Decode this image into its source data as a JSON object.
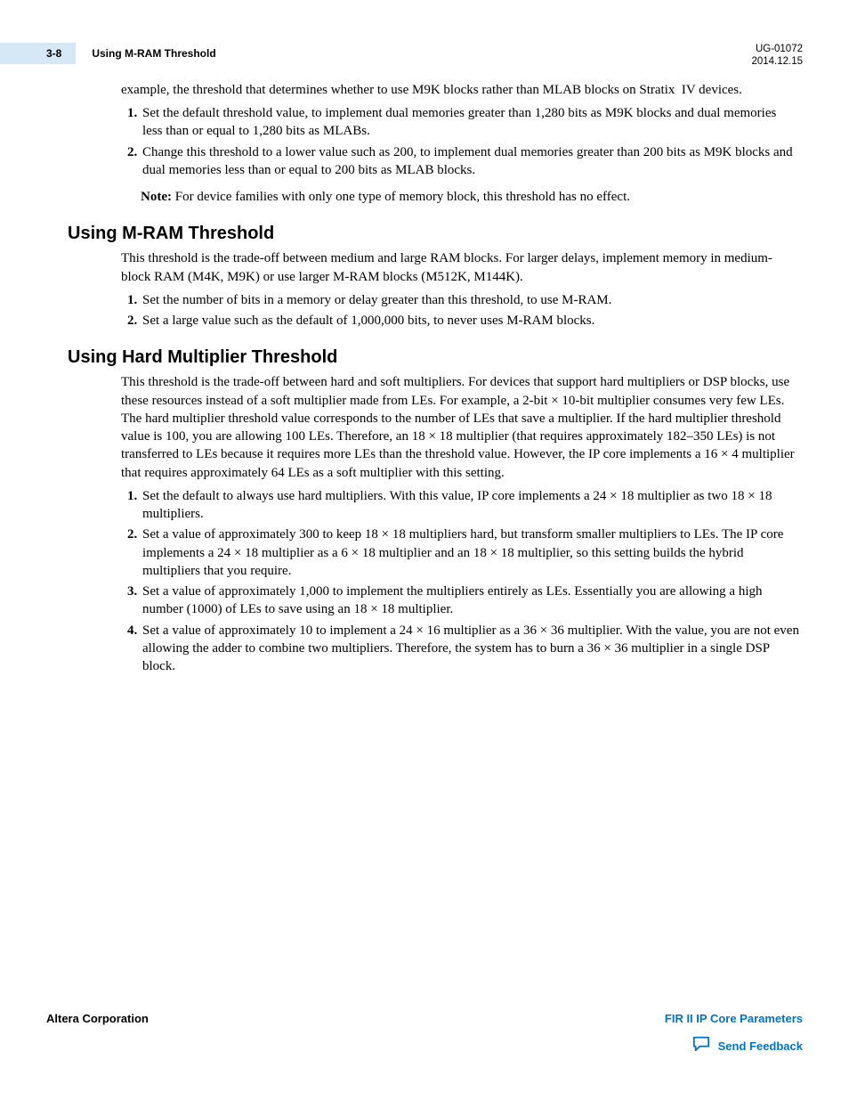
{
  "header": {
    "page_number": "3-8",
    "running_title": "Using M-RAM Threshold",
    "doc_id": "UG-01072",
    "date": "2014.12.15"
  },
  "intro_paragraph": "example, the threshold that determines whether to use M9K blocks rather than MLAB blocks on Stratix  IV devices.",
  "intro_list": [
    "Set the default threshold value, to implement dual memories greater than 1,280 bits as M9K blocks and dual memories less than or equal to 1,280 bits as MLABs.",
    "Change this threshold to a lower value such as 200, to implement dual memories greater than 200 bits as M9K blocks and dual memories less than or equal to 200 bits as MLAB blocks."
  ],
  "note_label": "Note:",
  "note_text": "For device families with only one type of memory block, this threshold has no effect.",
  "section_mram": {
    "title": "Using M-RAM Threshold",
    "para": "This threshold is the trade-off between medium and large RAM blocks. For larger delays, implement memory in medium-block RAM (M4K, M9K) or use larger M-RAM blocks (M512K, M144K).",
    "list": [
      "Set the number of bits in a memory or delay greater than this threshold, to use M-RAM.",
      "Set a large value such as the default of 1,000,000 bits, to never uses M-RAM blocks."
    ]
  },
  "section_hard": {
    "title": "Using Hard Multiplier Threshold",
    "para": "This threshold is the trade-off between hard and soft multipliers. For devices that support hard multipliers or DSP blocks, use these resources instead of a soft multiplier made from LEs. For example, a 2-bit × 10-bit multiplier consumes very few LEs. The hard multiplier threshold value corresponds to the number of LEs that save a multiplier. If the hard multiplier threshold value is 100, you are allowing 100 LEs. Therefore, an 18 × 18 multiplier (that requires approximately 182–350 LEs) is not transferred to LEs because it requires more LEs than the threshold value. However, the IP core implements a 16 × 4 multiplier that requires approximately 64 LEs as a soft multiplier with this setting.",
    "list": [
      "Set the default to always use hard multipliers. With this value, IP core implements a 24 × 18 multiplier as two 18 × 18 multipliers.",
      "Set a value of approximately 300 to keep 18 × 18 multipliers hard, but transform smaller multipliers to LEs. The IP core implements a 24 × 18 multiplier as a 6 × 18 multiplier and an 18 × 18 multiplier, so this setting builds the hybrid multipliers that you require.",
      "Set a value of approximately 1,000 to implement the multipliers entirely as LEs. Essentially you are allowing a high number (1000) of LEs to save using an 18 × 18 multiplier.",
      "Set a value of approximately 10 to implement a 24 × 16 multiplier as a 36 × 36 multiplier. With the value, you are not even allowing the adder to combine two multipliers. Therefore, the system has to burn a 36 × 36 multiplier in a single DSP block."
    ]
  },
  "footer": {
    "left": "Altera Corporation",
    "right": "FIR II IP Core Parameters",
    "feedback": "Send Feedback"
  }
}
